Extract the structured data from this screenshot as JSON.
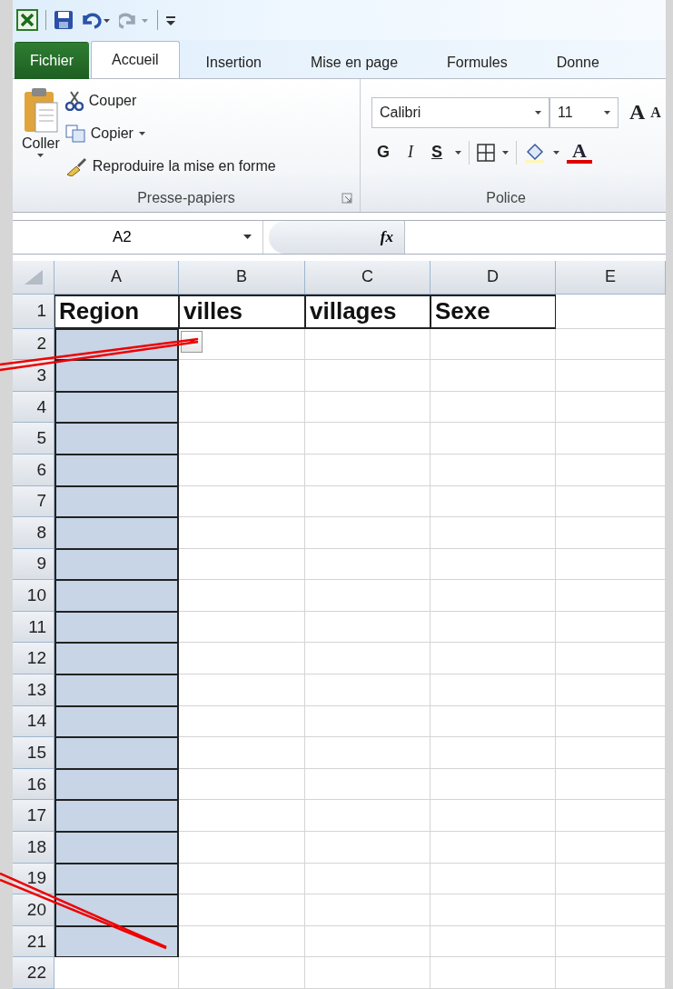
{
  "tabs": [
    {
      "label": "Fichier",
      "kind": "file",
      "selected": false
    },
    {
      "label": "Accueil",
      "kind": "tab",
      "selected": true
    },
    {
      "label": "Insertion",
      "kind": "tab",
      "selected": false
    },
    {
      "label": "Mise en page",
      "kind": "tab",
      "selected": false
    },
    {
      "label": "Formules",
      "kind": "tab",
      "selected": false
    },
    {
      "label": "Donne",
      "kind": "tab",
      "selected": false
    }
  ],
  "clipboard_group": {
    "title": "Presse-papiers",
    "paste": "Coller",
    "cut": "Couper",
    "copy": "Copier",
    "format_painter": "Reproduire la mise en forme"
  },
  "font_group": {
    "title": "Police",
    "font_name": "Calibri",
    "font_size": "11",
    "grow_font": "A",
    "shrink_font": "A",
    "bold": "G",
    "italic": "I",
    "underline": "S",
    "font_color": "A"
  },
  "formula_bar": {
    "name_box": "A2",
    "function_button": "fx"
  },
  "columns": [
    "A",
    "B",
    "C",
    "D",
    "E"
  ],
  "rows": [
    {
      "label": "1",
      "cells": [
        "Region",
        "villes",
        "villages",
        "Sexe"
      ],
      "selected": false,
      "dropdown": false
    },
    {
      "label": "2",
      "selected": true,
      "dropdown": true
    },
    {
      "label": "3",
      "selected": true,
      "dropdown": false
    },
    {
      "label": "4",
      "selected": true,
      "dropdown": false
    },
    {
      "label": "5",
      "selected": true,
      "dropdown": false
    },
    {
      "label": "6",
      "selected": true,
      "dropdown": false
    },
    {
      "label": "7",
      "selected": true,
      "dropdown": false
    },
    {
      "label": "8",
      "selected": true,
      "dropdown": false
    },
    {
      "label": "9",
      "selected": true,
      "dropdown": false
    },
    {
      "label": "10",
      "selected": true,
      "dropdown": false
    },
    {
      "label": "11",
      "selected": true,
      "dropdown": false
    },
    {
      "label": "12",
      "selected": true,
      "dropdown": false
    },
    {
      "label": "13",
      "selected": true,
      "dropdown": false
    },
    {
      "label": "14",
      "selected": true,
      "dropdown": false
    },
    {
      "label": "15",
      "selected": true,
      "dropdown": false
    },
    {
      "label": "16",
      "selected": true,
      "dropdown": false
    },
    {
      "label": "17",
      "selected": true,
      "dropdown": false
    },
    {
      "label": "18",
      "selected": true,
      "dropdown": false
    },
    {
      "label": "19",
      "selected": true,
      "dropdown": false
    },
    {
      "label": "20",
      "selected": true,
      "dropdown": false
    },
    {
      "label": "21",
      "selected": true,
      "dropdown": false
    },
    {
      "label": "22",
      "selected": false,
      "dropdown": false
    }
  ]
}
